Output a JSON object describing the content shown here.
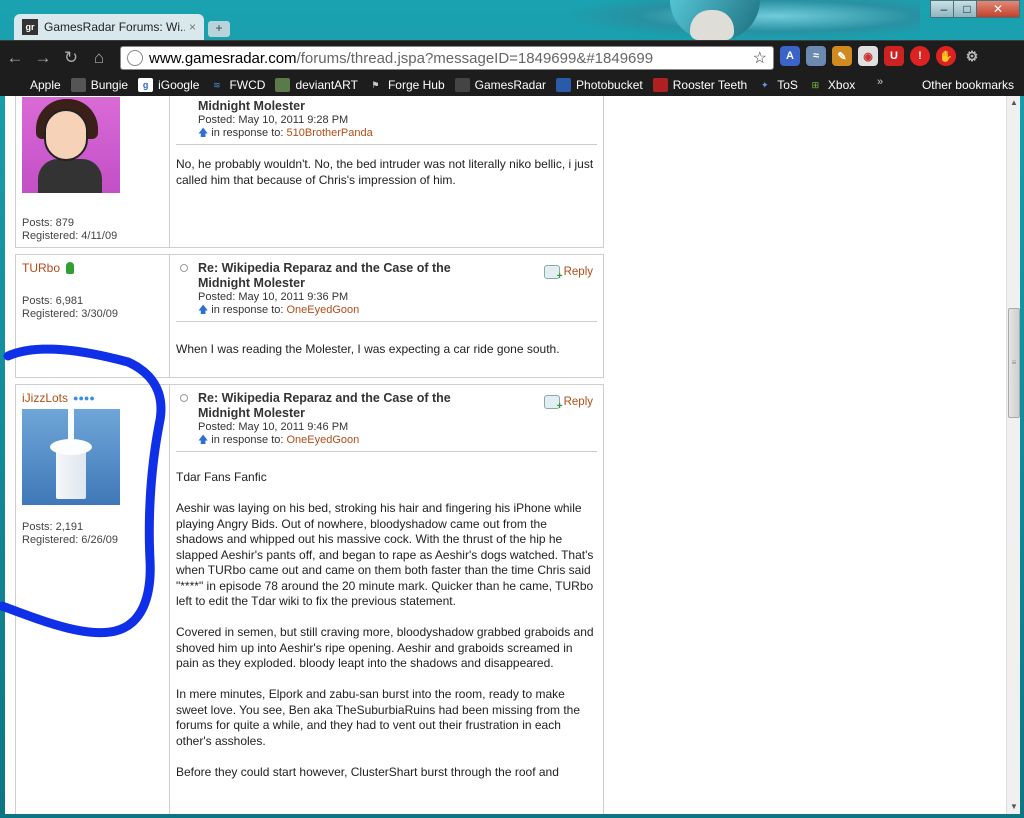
{
  "browser": {
    "tab_title": "GamesRadar Forums: Wi...",
    "tab_favicon": "gr",
    "tab_close": "×",
    "new_tab": "+",
    "window_controls": {
      "minimize": "‒",
      "maximize": "□",
      "close": "✕"
    },
    "url_host": "www.gamesradar.com",
    "url_path": "/forums/thread.jspa?messageID=1849699&#1849699",
    "bookmarks": [
      "Apple",
      "Bungie",
      "iGoogle",
      "FWCD",
      "deviantART",
      "Forge Hub",
      "GamesRadar",
      "Photobucket",
      "Rooster Teeth",
      "ToS",
      "Xbox"
    ],
    "bookmarks_overflow": "»",
    "other_bookmarks": "Other bookmarks"
  },
  "posts": [
    {
      "username": "",
      "avatar": "cartoon-avatar",
      "posts_count": "Posts: 879",
      "registered": "Registered: 4/11/09",
      "subject_line2": "Midnight Molester",
      "posted": "Posted: May 10, 2011 9:28 PM",
      "in_response_prefix": "in response to:",
      "in_response_user": "510BrotherPanda",
      "body": [
        "No, he probably wouldn't. No, the bed intruder was not literally niko bellic, i just called him that because of Chris's impression of him."
      ]
    },
    {
      "username": "TURbo",
      "posts_count": "Posts: 6,981",
      "registered": "Registered: 3/30/09",
      "subject_line1": "Re: Wikipedia Reparaz and the Case of the",
      "subject_line2": "Midnight Molester",
      "posted": "Posted: May 10, 2011 9:36 PM",
      "in_response_prefix": "in response to:",
      "in_response_user": "OneEyedGoon",
      "reply_label": "Reply",
      "body": [
        "When I was reading the Molester, I was expecting a car ride gone south."
      ]
    },
    {
      "username": "iJizzLots",
      "rank_dots": "●●●●",
      "avatar": "milk-glass-avatar",
      "posts_count": "Posts: 2,191",
      "registered": "Registered: 6/26/09",
      "subject_line1": "Re: Wikipedia Reparaz and the Case of the",
      "subject_line2": "Midnight Molester",
      "posted": "Posted: May 10, 2011 9:46 PM",
      "in_response_prefix": "in response to:",
      "in_response_user": "OneEyedGoon",
      "reply_label": "Reply",
      "body": [
        "Tdar Fans Fanfic",
        "Aeshir was laying on his bed, stroking his hair and fingering his iPhone while playing Angry Bids. Out of nowhere, bloodyshadow came out from the shadows and whipped out his massive cock. With the thrust of the hip he slapped Aeshir's pants off, and began to rape as Aeshir's dogs watched. That's when TURbo came out and came on them both faster than the time Chris said \"****\" in episode 78 around the 20 minute mark. Quicker than he came, TURbo left to edit the Tdar wiki to fix the previous statement.",
        "Covered in semen, but still craving more, bloodyshadow grabbed graboids and shoved him up into Aeshir's ripe opening. Aeshir and graboids screamed in pain as they exploded. bloody leapt into the shadows and disappeared.",
        "In mere minutes, Elpork and zabu-san burst into the room, ready to make sweet love. You see, Ben aka TheSuburbiaRuins had been missing from the forums for quite a while, and they had to vent out their frustration in each other's assholes.",
        "Before they could start however, ClusterShart burst through the roof and"
      ]
    }
  ],
  "colors": {
    "link": "#b24d17",
    "scribble": "#1030e8",
    "chrome_dark": "#1d1d1d"
  }
}
